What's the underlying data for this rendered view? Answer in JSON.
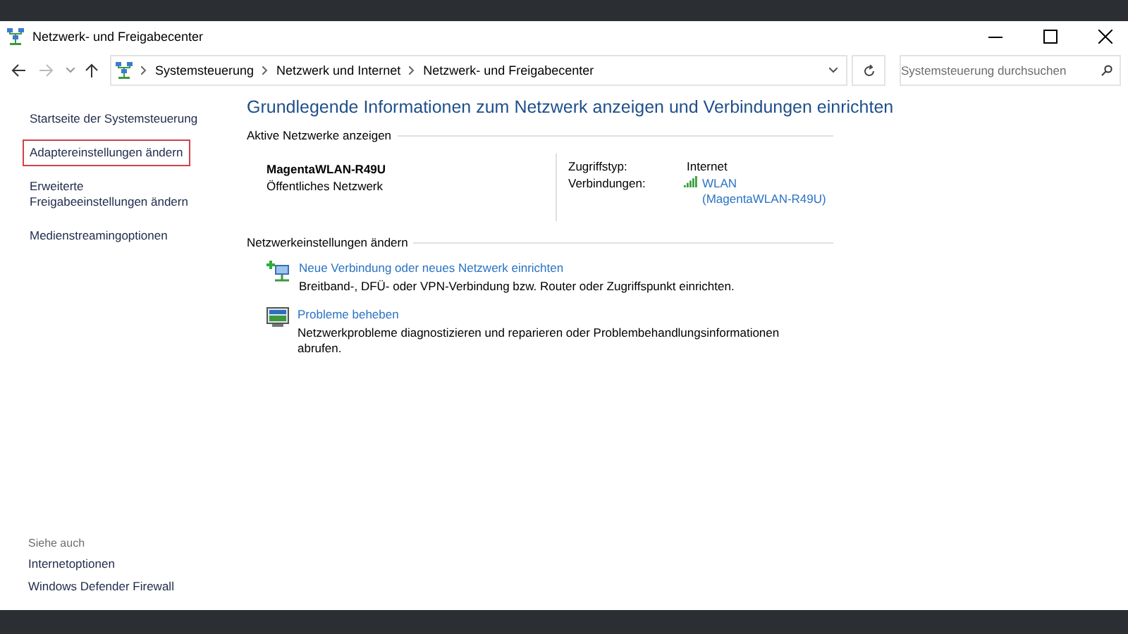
{
  "window": {
    "title": "Netzwerk- und Freigabecenter"
  },
  "address_bar": {
    "breadcrumbs": [
      "Systemsteuerung",
      "Netzwerk und Internet",
      "Netzwerk- und Freigabecenter"
    ]
  },
  "search": {
    "placeholder": "Systemsteuerung durchsuchen"
  },
  "sidebar": {
    "items": [
      {
        "label": "Startseite der Systemsteuerung",
        "highlighted": false
      },
      {
        "label": "Adaptereinstellungen ändern",
        "highlighted": true
      },
      {
        "label": "Erweiterte Freigabeeinstellungen ändern",
        "highlighted": false
      },
      {
        "label": "Medienstreamingoptionen",
        "highlighted": false
      }
    ],
    "see_also": {
      "heading": "Siehe auch",
      "items": [
        "Internetoptionen",
        "Windows Defender Firewall"
      ]
    }
  },
  "main": {
    "title": "Grundlegende Informationen zum Netzwerk anzeigen und Verbindungen einrichten",
    "active_networks": {
      "heading": "Aktive Netzwerke anzeigen",
      "network": {
        "name": "MagentaWLAN-R49U",
        "category": "Öffentliches Netzwerk"
      },
      "details": [
        {
          "label": "Zugriffstyp:",
          "kind": "text",
          "lines": [
            "Internet"
          ]
        },
        {
          "label": "Verbindungen:",
          "kind": "wifi-link",
          "lines": [
            "WLAN",
            "(MagentaWLAN-R49U)"
          ]
        }
      ]
    },
    "settings": {
      "heading": "Netzwerkeinstellungen ändern",
      "tasks": [
        {
          "kind": "new-connection",
          "title": "Neue Verbindung oder neues Netzwerk einrichten",
          "description": "Breitband-, DFÜ- oder VPN-Verbindung bzw. Router oder Zugriffspunkt einrichten."
        },
        {
          "kind": "troubleshoot",
          "title": "Probleme beheben",
          "description": "Netzwerkprobleme diagnostizieren und reparieren oder Problembehandlungsinformationen abrufen."
        }
      ]
    }
  }
}
